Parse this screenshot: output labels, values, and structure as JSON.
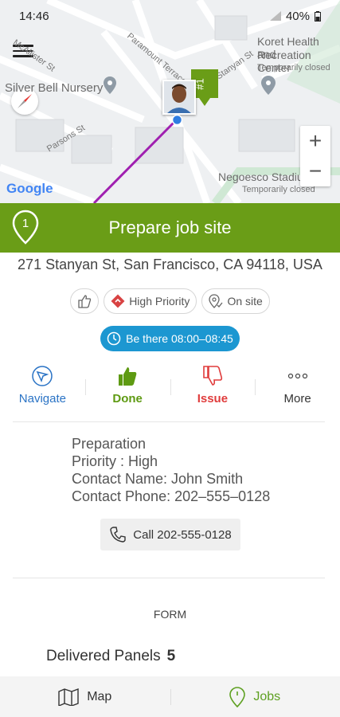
{
  "status_bar": {
    "time": "14:46",
    "battery": "40%"
  },
  "map": {
    "place_labels": {
      "silver_bell": "Silver Bell Nursery",
      "koret_line1": "Koret Health and",
      "koret_line2": "Recreation Center",
      "koret_note": "Temporarily closed",
      "negoesco": "Negoesco Stadium",
      "negoesco_note": "Temporarily closed"
    },
    "street_labels": {
      "stanyan": "Stanyan St",
      "parsons": "Parsons St",
      "mcallister": "McAllister St",
      "paramount": "Paramount Terrace"
    },
    "flag_label": "#1",
    "zoom_in": "+",
    "zoom_out": "−",
    "attribution": "Google",
    "route_color": "#a020b0"
  },
  "job": {
    "step_number": "1",
    "title": "Prepare job site",
    "address": "271 Stanyan St, San Francisco, CA 94118, USA",
    "chips": {
      "priority": "High Priority",
      "status": "On site"
    },
    "time_window": "Be there 08:00–08:45",
    "accent_color": "#6a9d17"
  },
  "actions": [
    {
      "label": "Navigate",
      "icon": "navigate-icon",
      "color": "#2a73c5"
    },
    {
      "label": "Done",
      "icon": "thumbs-up-icon",
      "color": "#5e9a12"
    },
    {
      "label": "Issue",
      "icon": "thumbs-down-icon",
      "color": "#e03c3c"
    },
    {
      "label": "More",
      "icon": "more-icon",
      "color": "#333333"
    }
  ],
  "details": {
    "line1": "Preparation",
    "line2": "Priority : High",
    "line3": "Contact Name: John Smith",
    "line4": "Contact Phone: 202–555–0128"
  },
  "call_button": "Call 202-555-0128",
  "form": {
    "label": "FORM",
    "field_label": "Delivered Panels",
    "field_value": "5"
  },
  "bottom_nav": {
    "map": "Map",
    "jobs": "Jobs"
  }
}
